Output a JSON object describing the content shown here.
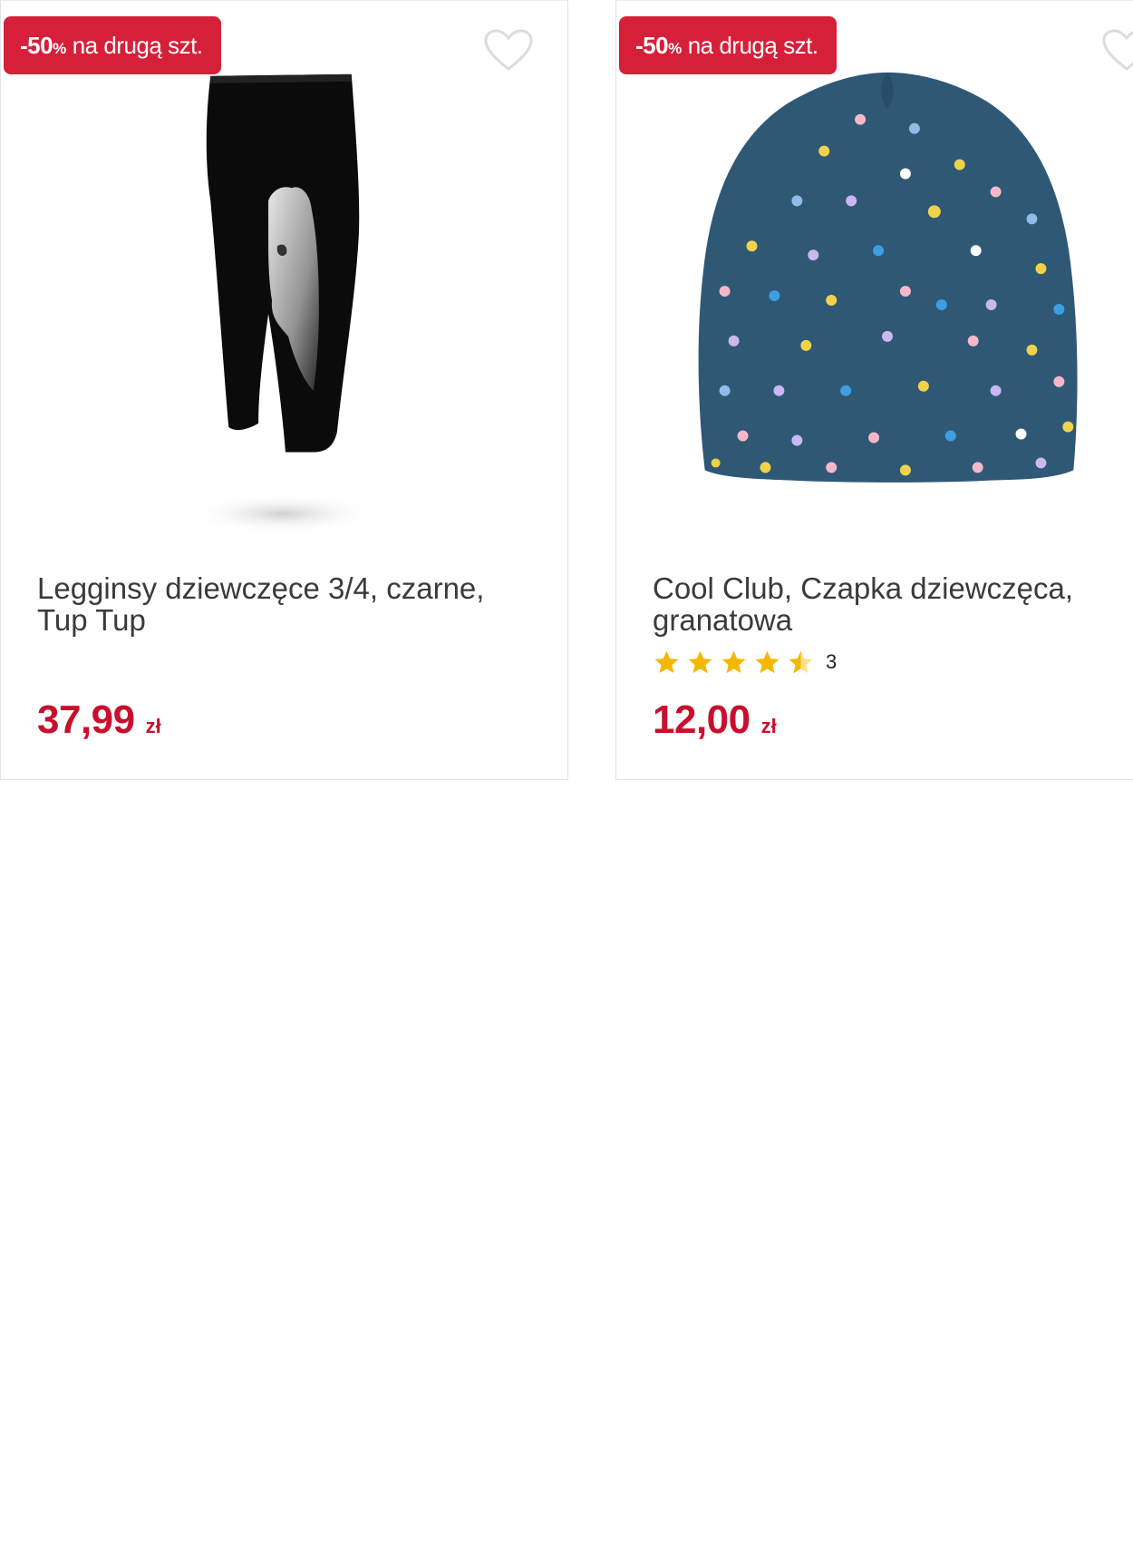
{
  "products": [
    {
      "promo_badge": {
        "percent": "-50",
        "percent_sign": "%",
        "text": "na drugą szt."
      },
      "image": "black-leggings-with-horse-print",
      "title": "Legginsy dziewczęce 3/4, czarne, Tup Tup",
      "price": "37,99",
      "currency": "zł",
      "wishlist_icon": "heart-outline-icon"
    },
    {
      "promo_badge": {
        "percent": "-50",
        "percent_sign": "%",
        "text": "na drugą szt."
      },
      "image": "navy-polka-dot-beanie",
      "title": "Cool Club, Czapka dziewczęca, granatowa",
      "rating": {
        "stars": 4.5,
        "max": 5,
        "count": "3"
      },
      "price": "12,00",
      "currency": "zł",
      "wishlist_icon": "heart-outline-icon"
    }
  ],
  "colors": {
    "badge_bg": "#d6203a",
    "price": "#c8102e",
    "star": "#f5b800",
    "beanie": "#2f5875"
  }
}
